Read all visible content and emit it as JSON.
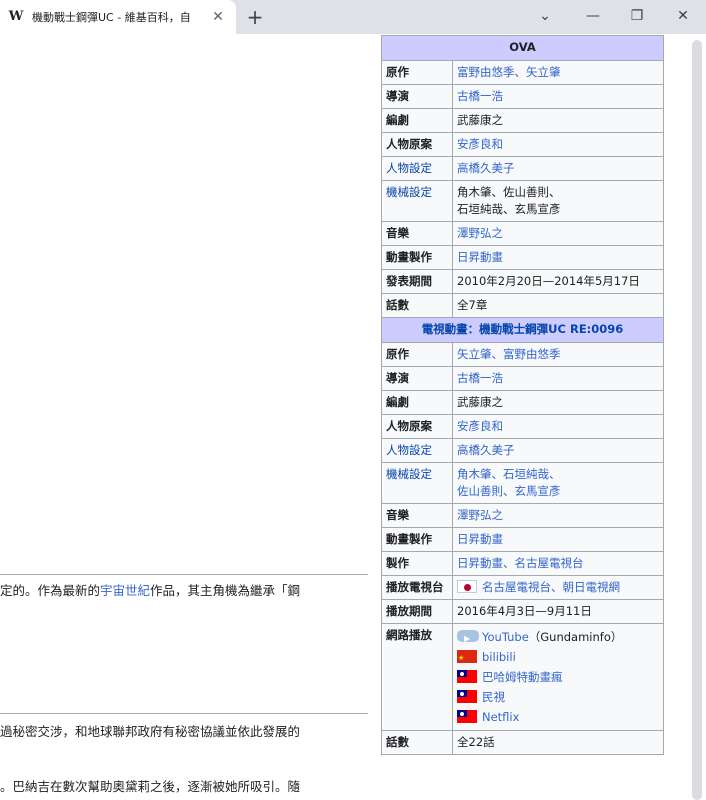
{
  "browser": {
    "tab_title": "機動戰士鋼彈UC - 維基百科，自",
    "favicon": "W",
    "close_glyph": "✕",
    "new_tab_glyph": "+",
    "controls": {
      "dropdown": "⌄",
      "minimize": "—",
      "restore": "❐",
      "close": "✕"
    }
  },
  "page": {
    "paragraphs": [
      {
        "prefix": "定的。作為最新的",
        "link": "宇宙世紀",
        "suffix": "作品，其主角機為繼承「鋼"
      },
      {
        "prefix": "過秘密交涉，和地球聯邦政府有秘密協議並依此發展的",
        "link": "",
        "suffix": ""
      },
      {
        "prefix": "。巴納吉在數次幫助奧黛莉之後，逐漸被她所吸引。隨",
        "link": "",
        "suffix": ""
      }
    ]
  },
  "infobox": {
    "ova": {
      "header": "OVA",
      "rows": [
        {
          "label": "原作",
          "values": [
            "富野由悠季、矢立肇"
          ],
          "label_link": false,
          "value_link": true
        },
        {
          "label": "導演",
          "values": [
            "古橋一浩"
          ],
          "label_link": false,
          "value_link": true
        },
        {
          "label": "編劇",
          "values": [
            "武藤康之"
          ],
          "label_link": false,
          "value_link": false
        },
        {
          "label": "人物原案",
          "values": [
            "安彥良和"
          ],
          "label_link": false,
          "value_link": true
        },
        {
          "label": "人物設定",
          "values": [
            "高橋久美子"
          ],
          "label_link": true,
          "value_link": true
        },
        {
          "label": "機械設定",
          "values": [
            "角木肇、佐山善則、",
            "石垣純哉、玄馬宣彥"
          ],
          "label_link": true,
          "value_link": false
        },
        {
          "label": "音樂",
          "values": [
            "澤野弘之"
          ],
          "label_link": false,
          "value_link": true
        },
        {
          "label": "動畫製作",
          "values": [
            "日昇動畫"
          ],
          "label_link": false,
          "value_link": true
        },
        {
          "label": "發表期間",
          "values": [
            "2010年2月20日—2014年5月17日"
          ],
          "label_link": false,
          "value_link": false
        },
        {
          "label": "話數",
          "values": [
            "全7章"
          ],
          "label_link": false,
          "value_link": false
        }
      ]
    },
    "tv": {
      "header": "電視動畫：機動戰士鋼彈UC RE:0096",
      "rows": [
        {
          "label": "原作",
          "values": [
            "矢立肇、富野由悠季"
          ],
          "label_link": false,
          "value_link": true
        },
        {
          "label": "導演",
          "values": [
            "古橋一浩"
          ],
          "label_link": false,
          "value_link": true
        },
        {
          "label": "編劇",
          "values": [
            "武藤康之"
          ],
          "label_link": false,
          "value_link": false
        },
        {
          "label": "人物原案",
          "values": [
            "安彥良和"
          ],
          "label_link": false,
          "value_link": true
        },
        {
          "label": "人物設定",
          "values": [
            "高橋久美子"
          ],
          "label_link": true,
          "value_link": true
        },
        {
          "label": "機械設定",
          "values": [
            "角木肇、石垣純哉、",
            "佐山善則、玄馬宣彥"
          ],
          "label_link": true,
          "value_link": true
        },
        {
          "label": "音樂",
          "values": [
            "澤野弘之"
          ],
          "label_link": false,
          "value_link": true
        },
        {
          "label": "動畫製作",
          "values": [
            "日昇動畫"
          ],
          "label_link": false,
          "value_link": true
        },
        {
          "label": "製作",
          "values": [
            "日昇動畫、名古屋電視台"
          ],
          "label_link": false,
          "value_link": true
        }
      ],
      "broadcaster": {
        "label": "播放電視台",
        "flag": "japan-flag",
        "value": "名古屋電視台、朝日電視網"
      },
      "period": {
        "label": "播放期間",
        "value": "2016年4月3日—9月11日"
      },
      "streaming": {
        "label": "網路播放",
        "items": [
          {
            "icon": "youtube-icon",
            "name": "YouTube",
            "note": "（Gundaminfo）"
          },
          {
            "icon": "china-flag",
            "name": "bilibili",
            "note": ""
          },
          {
            "icon": "taiwan-flag",
            "name": "巴哈姆特動畫瘋",
            "note": ""
          },
          {
            "icon": "taiwan-flag",
            "name": "民視",
            "note": ""
          },
          {
            "icon": "taiwan-flag",
            "name": "Netflix",
            "note": ""
          }
        ]
      },
      "episodes": {
        "label": "話數",
        "value": "全22話"
      }
    }
  },
  "colors": {
    "header_bg": "#ccccff",
    "link": "#3366cc",
    "border": "#a2a9b1",
    "box_bg": "#f8f9fa"
  }
}
